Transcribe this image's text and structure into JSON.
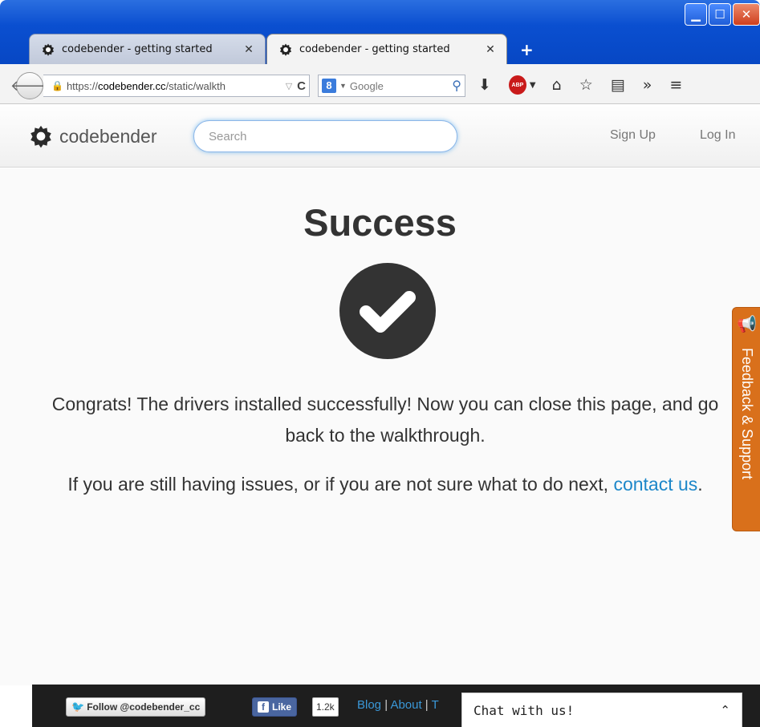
{
  "browser": {
    "tabs": [
      {
        "title": "codebender - getting started",
        "close": "✕",
        "active": false
      },
      {
        "title": "codebender - getting started",
        "close": "✕",
        "active": true
      }
    ],
    "newtab": "+",
    "window_buttons": {
      "minimize": "▁",
      "maximize": "☐",
      "close": "✕"
    },
    "url_prefix": "https://",
    "url_host": "codebender.cc",
    "url_path": "/static/walkth",
    "search_engine": "Google"
  },
  "site": {
    "logo_text": "codebender",
    "search_placeholder": "Search",
    "nav": {
      "signup": "Sign Up",
      "login": "Log In"
    }
  },
  "content": {
    "headline": "Success",
    "message1": "Congrats! The drivers installed successfully! Now you can close this page, and go back to the walkthrough.",
    "message2_prefix": "If you are still having issues, or if you are not sure what to do next,",
    "contact_link": "contact us",
    "message2_suffix": "."
  },
  "feedback": {
    "label": "Feedback & Support"
  },
  "footer": {
    "twitter": "Follow @codebender_cc",
    "fb_like": "Like",
    "fb_count": "1.2k",
    "links": [
      "Blog",
      "About",
      "T"
    ]
  },
  "chat": {
    "label": "Chat with us!",
    "chevron": "⌃"
  },
  "colors": {
    "accent": "#1d87c9",
    "feedback": "#d9701b",
    "footer": "#1e1e1e",
    "titlebar": "#0a4fd0"
  }
}
